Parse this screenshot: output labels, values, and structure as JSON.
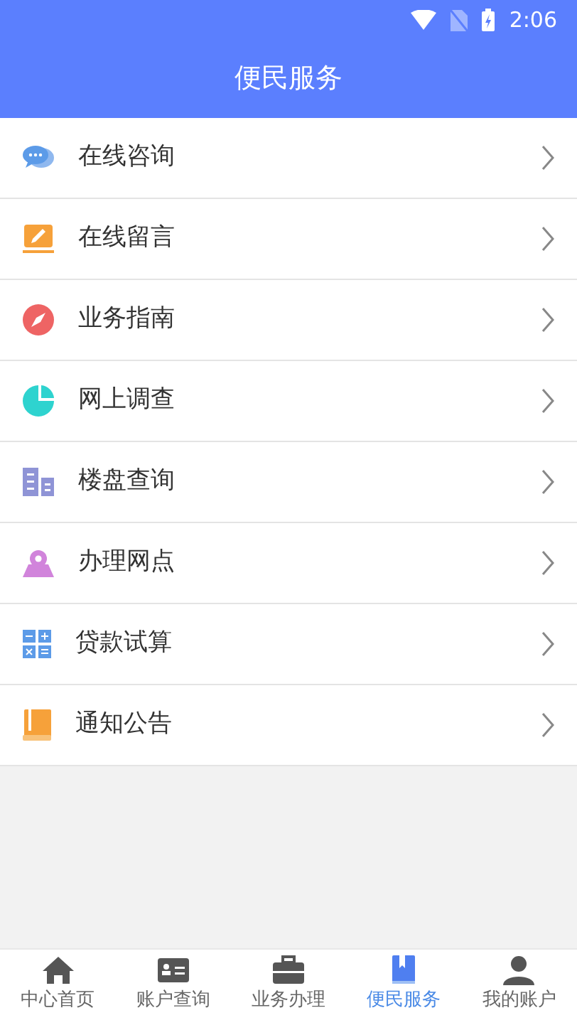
{
  "status_bar": {
    "time": "2:06"
  },
  "header": {
    "title": "便民服务"
  },
  "menu": [
    {
      "label": "在线咨询"
    },
    {
      "label": "在线留言"
    },
    {
      "label": "业务指南"
    },
    {
      "label": "网上调查"
    },
    {
      "label": "楼盘查询"
    },
    {
      "label": "办理网点"
    },
    {
      "label": "贷款试算"
    },
    {
      "label": "通知公告"
    }
  ],
  "tab_bar": [
    {
      "label": "中心首页",
      "selected": false
    },
    {
      "label": "账户查询",
      "selected": false
    },
    {
      "label": "业务办理",
      "selected": false
    },
    {
      "label": "便民服务",
      "selected": true
    },
    {
      "label": "我的账户",
      "selected": false
    }
  ]
}
